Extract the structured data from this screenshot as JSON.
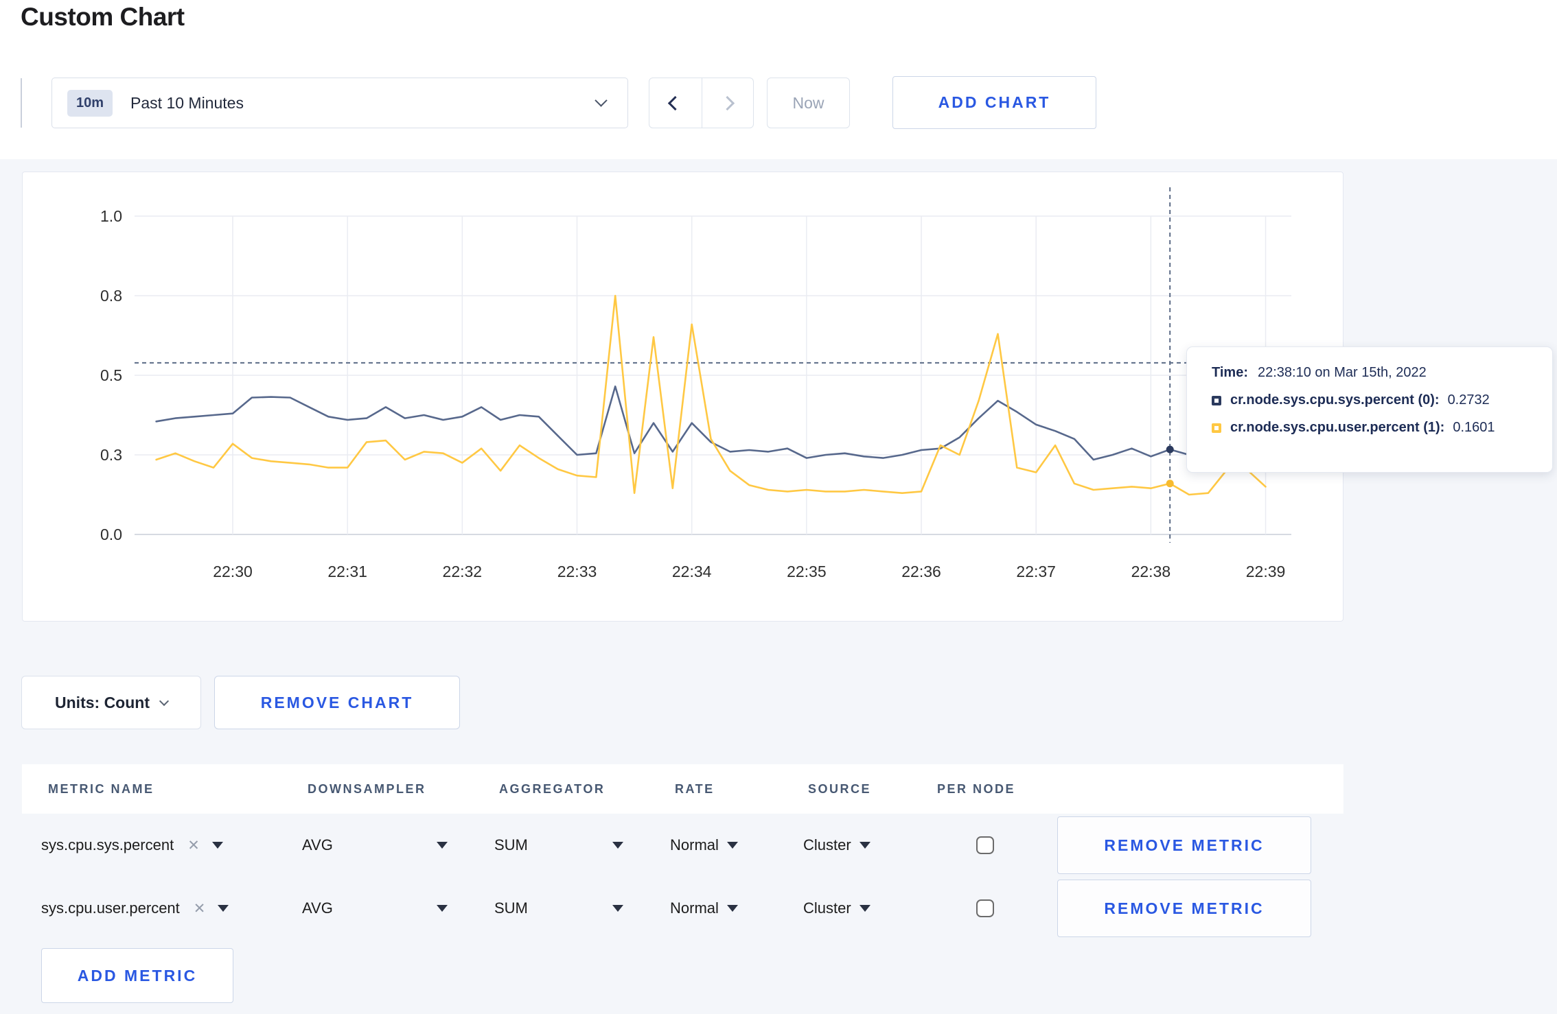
{
  "page_title": "Custom Chart",
  "toolbar": {
    "time_window_badge": "10m",
    "time_window_label": "Past 10 Minutes",
    "back_icon": "chevron-left",
    "forward_icon": "chevron-right",
    "now_label": "Now",
    "add_chart_label": "ADD CHART"
  },
  "tooltip": {
    "time_label": "Time:",
    "time_value": "22:38:10 on Mar 15th, 2022",
    "series": [
      {
        "label": "cr.node.sys.cpu.sys.percent (0):",
        "value": "0.2732",
        "color": "#2b3a5e"
      },
      {
        "label": "cr.node.sys.cpu.user.percent (1):",
        "value": "0.1601",
        "color": "#ffc843"
      }
    ]
  },
  "chart_footer": {
    "units_label": "Units: Count",
    "remove_chart_label": "REMOVE CHART"
  },
  "metrics_table": {
    "headers": [
      "METRIC NAME",
      "DOWNSAMPLER",
      "AGGREGATOR",
      "RATE",
      "SOURCE",
      "PER NODE"
    ],
    "rows": [
      {
        "metric": "sys.cpu.sys.percent",
        "downsampler": "AVG",
        "aggregator": "SUM",
        "rate": "Normal",
        "source": "Cluster",
        "per_node_checked": false
      },
      {
        "metric": "sys.cpu.user.percent",
        "downsampler": "AVG",
        "aggregator": "SUM",
        "rate": "Normal",
        "source": "Cluster",
        "per_node_checked": false
      }
    ],
    "remove_metric_label": "REMOVE METRIC",
    "add_metric_label": "ADD METRIC"
  },
  "chart_data": {
    "type": "line",
    "title": "",
    "ylim": [
      0,
      1
    ],
    "grid": true,
    "legend_position": "tooltip",
    "y_ticks": [
      {
        "label": "0.0",
        "value": 0.0
      },
      {
        "label": "0.3",
        "value": 0.25
      },
      {
        "label": "0.5",
        "value": 0.5
      },
      {
        "label": "0.8",
        "value": 0.75
      },
      {
        "label": "1.0",
        "value": 1.0
      }
    ],
    "x_ticks": [
      "22:30",
      "22:31",
      "22:32",
      "22:33",
      "22:34",
      "22:35",
      "22:36",
      "22:37",
      "22:38",
      "22:39"
    ],
    "start_time": "22:29:20",
    "sample_interval_seconds": 10,
    "series": [
      {
        "name": "cr.node.sys.cpu.sys.percent",
        "color": "#57688c",
        "marker_color": "#2b3a5e",
        "values": [
          0.355,
          0.365,
          0.37,
          0.375,
          0.38,
          0.43,
          0.432,
          0.43,
          0.4,
          0.37,
          0.36,
          0.365,
          0.4,
          0.365,
          0.375,
          0.36,
          0.37,
          0.4,
          0.36,
          0.375,
          0.37,
          0.31,
          0.25,
          0.255,
          0.465,
          0.255,
          0.35,
          0.26,
          0.35,
          0.29,
          0.26,
          0.265,
          0.26,
          0.27,
          0.24,
          0.25,
          0.255,
          0.245,
          0.24,
          0.25,
          0.265,
          0.27,
          0.305,
          0.365,
          0.42,
          0.385,
          0.345,
          0.325,
          0.3,
          0.235,
          0.25,
          0.27,
          0.245,
          0.267,
          0.25
        ]
      },
      {
        "name": "cr.node.sys.cpu.user.percent",
        "color": "#ffc843",
        "marker_color": "#f7bb2e",
        "values": [
          0.235,
          0.255,
          0.23,
          0.21,
          0.285,
          0.24,
          0.23,
          0.225,
          0.22,
          0.21,
          0.21,
          0.29,
          0.295,
          0.235,
          0.26,
          0.255,
          0.225,
          0.27,
          0.2,
          0.28,
          0.24,
          0.205,
          0.185,
          0.18,
          0.75,
          0.13,
          0.62,
          0.145,
          0.66,
          0.3,
          0.2,
          0.155,
          0.14,
          0.135,
          0.14,
          0.135,
          0.135,
          0.14,
          0.135,
          0.13,
          0.135,
          0.28,
          0.25,
          0.42,
          0.63,
          0.21,
          0.195,
          0.28,
          0.16,
          0.14,
          0.145,
          0.15,
          0.145,
          0.1601,
          0.125,
          0.13,
          0.205,
          0.205,
          0.15
        ]
      }
    ],
    "crosshair": {
      "index": 53,
      "time": "22:38:10",
      "hover_value": 0.539,
      "color": "#5a6a85"
    },
    "grid_color": "#eaecf2",
    "axis_color": "#c9ced9",
    "tick_label_color": "#2e2e2e"
  }
}
